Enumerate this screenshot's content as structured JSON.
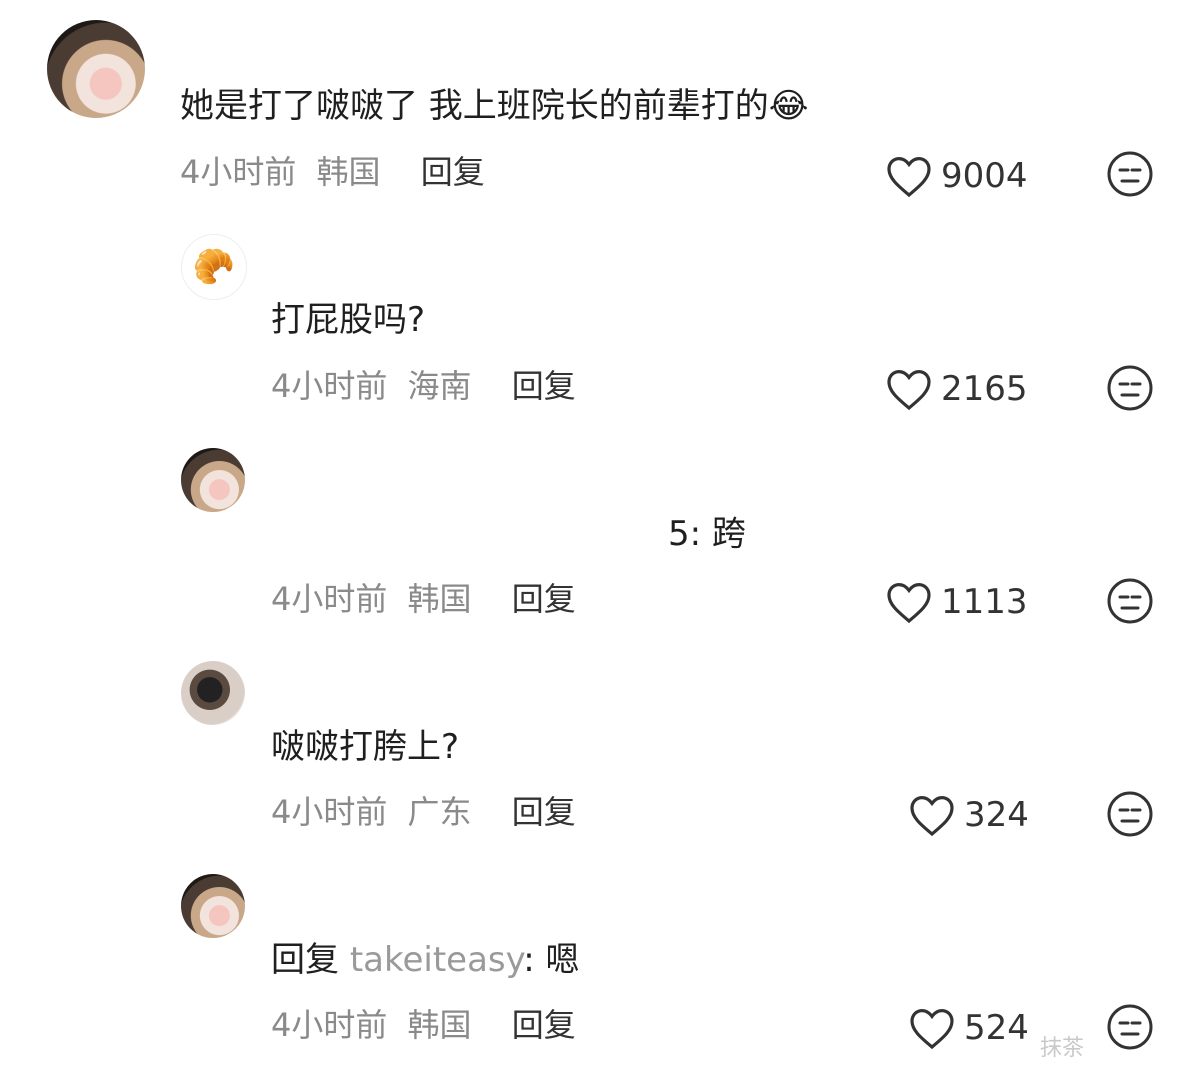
{
  "comments": [
    {
      "avatar": "pig-avatar",
      "text": "她是打了啵啵了 我上班院长的前辈打的😂",
      "time": "4小时前",
      "region": "韩国",
      "reply_label": "回复",
      "likes": "9004"
    },
    {
      "avatar": "croissant-avatar",
      "text": "打屁股吗?",
      "time": "4小时前",
      "region": "海南",
      "reply_label": "回复",
      "likes": "2165"
    },
    {
      "avatar": "pig-avatar",
      "text": "5: 跨",
      "time": "4小时前",
      "region": "韩国",
      "reply_label": "回复",
      "likes": "1113"
    },
    {
      "avatar": "dog-avatar",
      "text": "啵啵打胯上?",
      "time": "4小时前",
      "region": "广东",
      "reply_label": "回复",
      "likes": "324"
    },
    {
      "avatar": "pig-avatar",
      "reply_prefix": "回复",
      "reply_user": "takeiteasy",
      "reply_suffix": ": 嗯",
      "time": "4小时前",
      "region": "韩国",
      "reply_label": "回复",
      "likes": "524"
    }
  ],
  "icons": {
    "like": "heart-outline-icon",
    "dislike": "neutral-face-icon"
  },
  "colors": {
    "meta_text": "#8a8a8a",
    "body_text": "#1f1f1f"
  },
  "watermark": "抹茶"
}
